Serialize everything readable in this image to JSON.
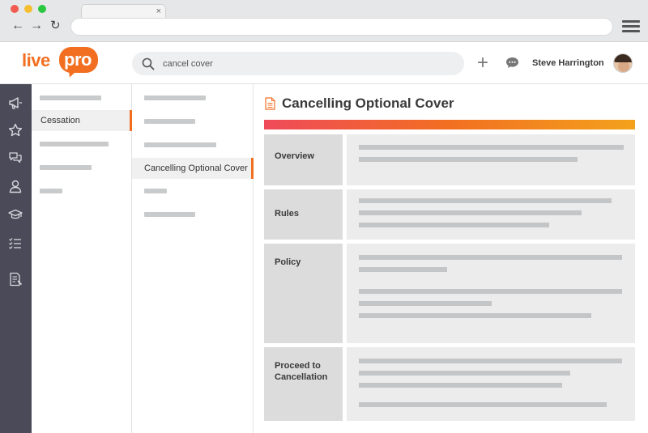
{
  "browser": {
    "tab_close": "×",
    "nav_back": "←",
    "nav_forward": "→",
    "nav_reload": "↻"
  },
  "app": {
    "logo_live": "live",
    "logo_pro": "pro",
    "accent_color": "#f26f21",
    "search": {
      "value": "cancel cover"
    },
    "plus": "+",
    "user_name": "Steve  Harrington"
  },
  "rail": {
    "icons": [
      "megaphone-icon",
      "star-icon",
      "chat-bubbles-icon",
      "person-icon",
      "graduation-cap-icon",
      "checklist-icon",
      "document-edit-icon"
    ]
  },
  "col1": {
    "selected_label": "Cessation"
  },
  "col2": {
    "selected_label": "Cancelling Optional Cover"
  },
  "main": {
    "title": "Cancelling Optional Cover",
    "sections": [
      {
        "label": "Overview"
      },
      {
        "label": "Rules"
      },
      {
        "label": "Policy"
      },
      {
        "label": "Proceed to Cancellation"
      }
    ]
  }
}
